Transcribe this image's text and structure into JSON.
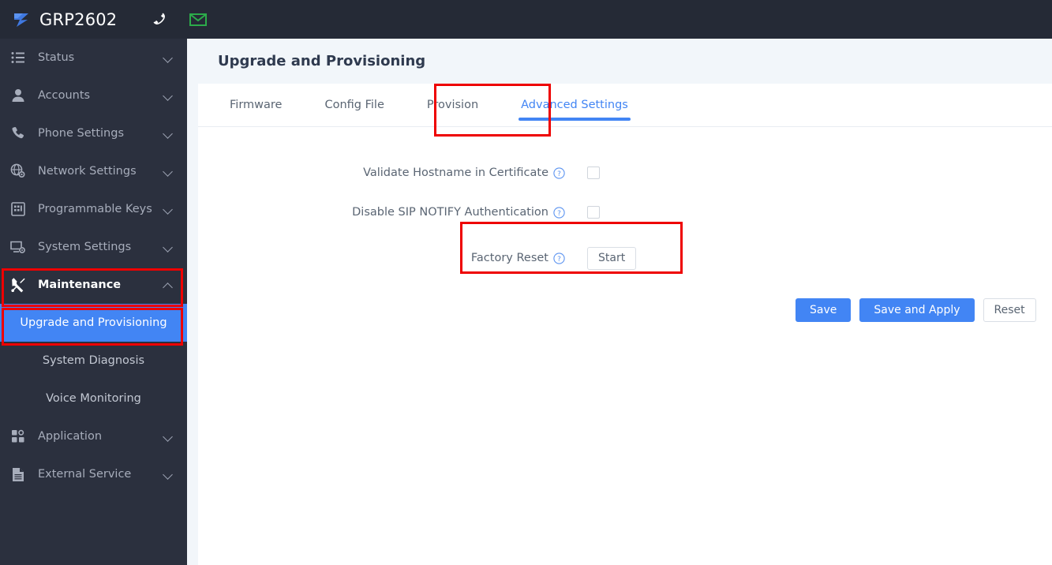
{
  "topbar": {
    "logo_icon": "grandstream-logo-icon",
    "device_model": "GRP2602",
    "phone_icon": "phone-handset-icon",
    "mail_icon": "envelope-icon",
    "logo_color": "#3f78e0",
    "mail_color": "#2cab4a",
    "background": "#252a36"
  },
  "sidebar": {
    "background": "#2b303e",
    "active_color": "#4285f4",
    "items": [
      {
        "label": "Status",
        "icon": "list-icon",
        "expandable": true,
        "expanded": false
      },
      {
        "label": "Accounts",
        "icon": "user-icon",
        "expandable": true,
        "expanded": false
      },
      {
        "label": "Phone Settings",
        "icon": "phone-icon",
        "expandable": true,
        "expanded": false
      },
      {
        "label": "Network Settings",
        "icon": "globe-gear-icon",
        "expandable": true,
        "expanded": false
      },
      {
        "label": "Programmable Keys",
        "icon": "keypad-grid-icon",
        "expandable": true,
        "expanded": false
      },
      {
        "label": "System Settings",
        "icon": "monitor-gear-icon",
        "expandable": true,
        "expanded": false
      },
      {
        "label": "Maintenance",
        "icon": "wrench-screwdriver-icon",
        "expandable": true,
        "expanded": true
      },
      {
        "label": "Application",
        "icon": "apps-grid-icon",
        "expandable": true,
        "expanded": false
      },
      {
        "label": "External Service",
        "icon": "document-icon",
        "expandable": true,
        "expanded": false
      }
    ],
    "maintenance_children": [
      {
        "label": "Upgrade and Provisioning",
        "active": true
      },
      {
        "label": "System Diagnosis",
        "active": false
      },
      {
        "label": "Voice Monitoring",
        "active": false
      }
    ]
  },
  "main": {
    "page_title": "Upgrade and Provisioning",
    "tabs": [
      {
        "label": "Firmware",
        "active": false
      },
      {
        "label": "Config File",
        "active": false
      },
      {
        "label": "Provision",
        "active": false
      },
      {
        "label": "Advanced Settings",
        "active": true
      }
    ],
    "form_rows": [
      {
        "label": "Validate Hostname in Certificate",
        "help_icon": "help-circle-icon",
        "control": "checkbox",
        "checked": false
      },
      {
        "label": "Disable SIP NOTIFY Authentication",
        "help_icon": "help-circle-icon",
        "control": "checkbox",
        "checked": false
      },
      {
        "label": "Factory Reset",
        "help_icon": "help-circle-icon",
        "control": "button",
        "button_label": "Start"
      }
    ],
    "actions": [
      {
        "label": "Save",
        "style": "primary"
      },
      {
        "label": "Save and Apply",
        "style": "primary"
      },
      {
        "label": "Reset",
        "style": "outline"
      }
    ]
  },
  "annotations": {
    "color": "#ee0000",
    "boxes": [
      "sidebar-maintenance-highlight",
      "sidebar-upgrade-and-provisioning-highlight",
      "tab-advanced-settings-highlight",
      "factory-reset-row-highlight"
    ]
  }
}
